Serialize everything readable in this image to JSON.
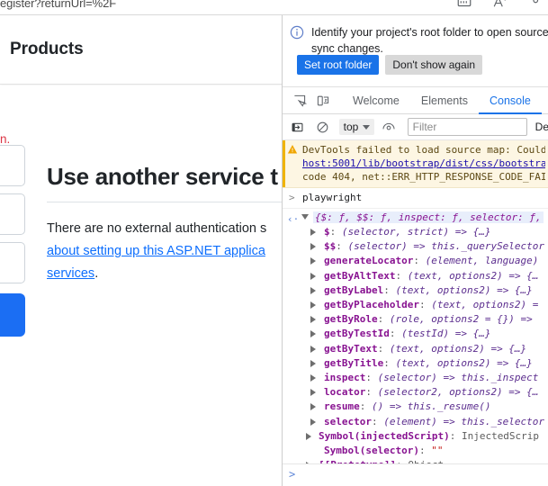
{
  "browser": {
    "omnibox_text": "egister?returnUrl=%2F",
    "icons": [
      "card-icon",
      "font-size-icon",
      "extensions-icon"
    ]
  },
  "page": {
    "brand": "Products",
    "form": {
      "error_text": "n.",
      "fields": [
        "field-1",
        "field-2",
        "field-3"
      ],
      "submit_color": "#1b6ef3"
    },
    "external": {
      "title": "Use another service t",
      "paragraph_lead": "There are no external authentication s",
      "link_line_1": "about setting up this ASP.NET applica",
      "link_line_2": "services",
      "trailing": "."
    }
  },
  "devtools": {
    "banner": {
      "icon": "info-icon",
      "line_1": "Identify your project's root folder to open source f",
      "line_2": "sync changes.",
      "primary_button": "Set root folder",
      "secondary_button": "Don't show again"
    },
    "toolbar_icons": [
      "inspect-element-icon",
      "device-toolbar-icon"
    ],
    "tabs": [
      {
        "label": "Welcome",
        "active": false
      },
      {
        "label": "Elements",
        "active": false
      },
      {
        "label": "Console",
        "active": true
      }
    ],
    "console_toolbar": {
      "sidebar_icon": "console-sidebar-icon",
      "clear_icon": "clear-console-icon",
      "context": "top",
      "eye_icon": "live-expression-icon",
      "filter_placeholder": "Filter",
      "levels_label": "De"
    },
    "console": {
      "warning": {
        "icon": "warning-icon",
        "line_1": "DevTools failed to load source map: Could",
        "line_2": "host:5001/lib/bootstrap/dist/css/bootstra",
        "line_3": "code 404, net::ERR_HTTP_RESPONSE_CODE_FAI"
      },
      "input_expression": "playwright",
      "result_preview": "{$: ƒ, $$: ƒ, inspect: ƒ, selector: ƒ,",
      "properties": [
        {
          "chevron": true,
          "key": "$",
          "value": "(selector, strict) => {…}",
          "style": "fn"
        },
        {
          "chevron": true,
          "key": "$$",
          "value": "(selector) => this._querySelector",
          "style": "fn"
        },
        {
          "chevron": true,
          "key": "generateLocator",
          "value": "(element, language)",
          "style": "fn"
        },
        {
          "chevron": true,
          "key": "getByAltText",
          "value": "(text, options2) => {…",
          "style": "fn"
        },
        {
          "chevron": true,
          "key": "getByLabel",
          "value": "(text, options2) => {…}",
          "style": "fn"
        },
        {
          "chevron": true,
          "key": "getByPlaceholder",
          "value": "(text, options2) =",
          "style": "fn"
        },
        {
          "chevron": true,
          "key": "getByRole",
          "value": "(role, options2 = {}) =>",
          "style": "fn"
        },
        {
          "chevron": true,
          "key": "getByTestId",
          "value": "(testId) => {…}",
          "style": "fn"
        },
        {
          "chevron": true,
          "key": "getByText",
          "value": "(text, options2) => {…}",
          "style": "fn"
        },
        {
          "chevron": true,
          "key": "getByTitle",
          "value": "(text, options2) => {…}",
          "style": "fn"
        },
        {
          "chevron": true,
          "key": "inspect",
          "value": "(selector) => this._inspect",
          "style": "fn"
        },
        {
          "chevron": true,
          "key": "locator",
          "value": "(selector2, options2) => {…",
          "style": "fn"
        },
        {
          "chevron": true,
          "key": "resume",
          "value": "() => this._resume()",
          "style": "fn"
        },
        {
          "chevron": true,
          "key": "selector",
          "value": "(element) => this._selector",
          "style": "fn"
        },
        {
          "chevron": true,
          "key": "Symbol(injectedScript)",
          "value": "InjectedScrip",
          "style": "plain"
        },
        {
          "chevron": false,
          "key": "Symbol(selector)",
          "value": "\"\"",
          "style": "str"
        },
        {
          "chevron": true,
          "key": "[[Prototype]]",
          "value": "Object",
          "style": "proto"
        }
      ],
      "prompt_glyph": ">"
    }
  }
}
